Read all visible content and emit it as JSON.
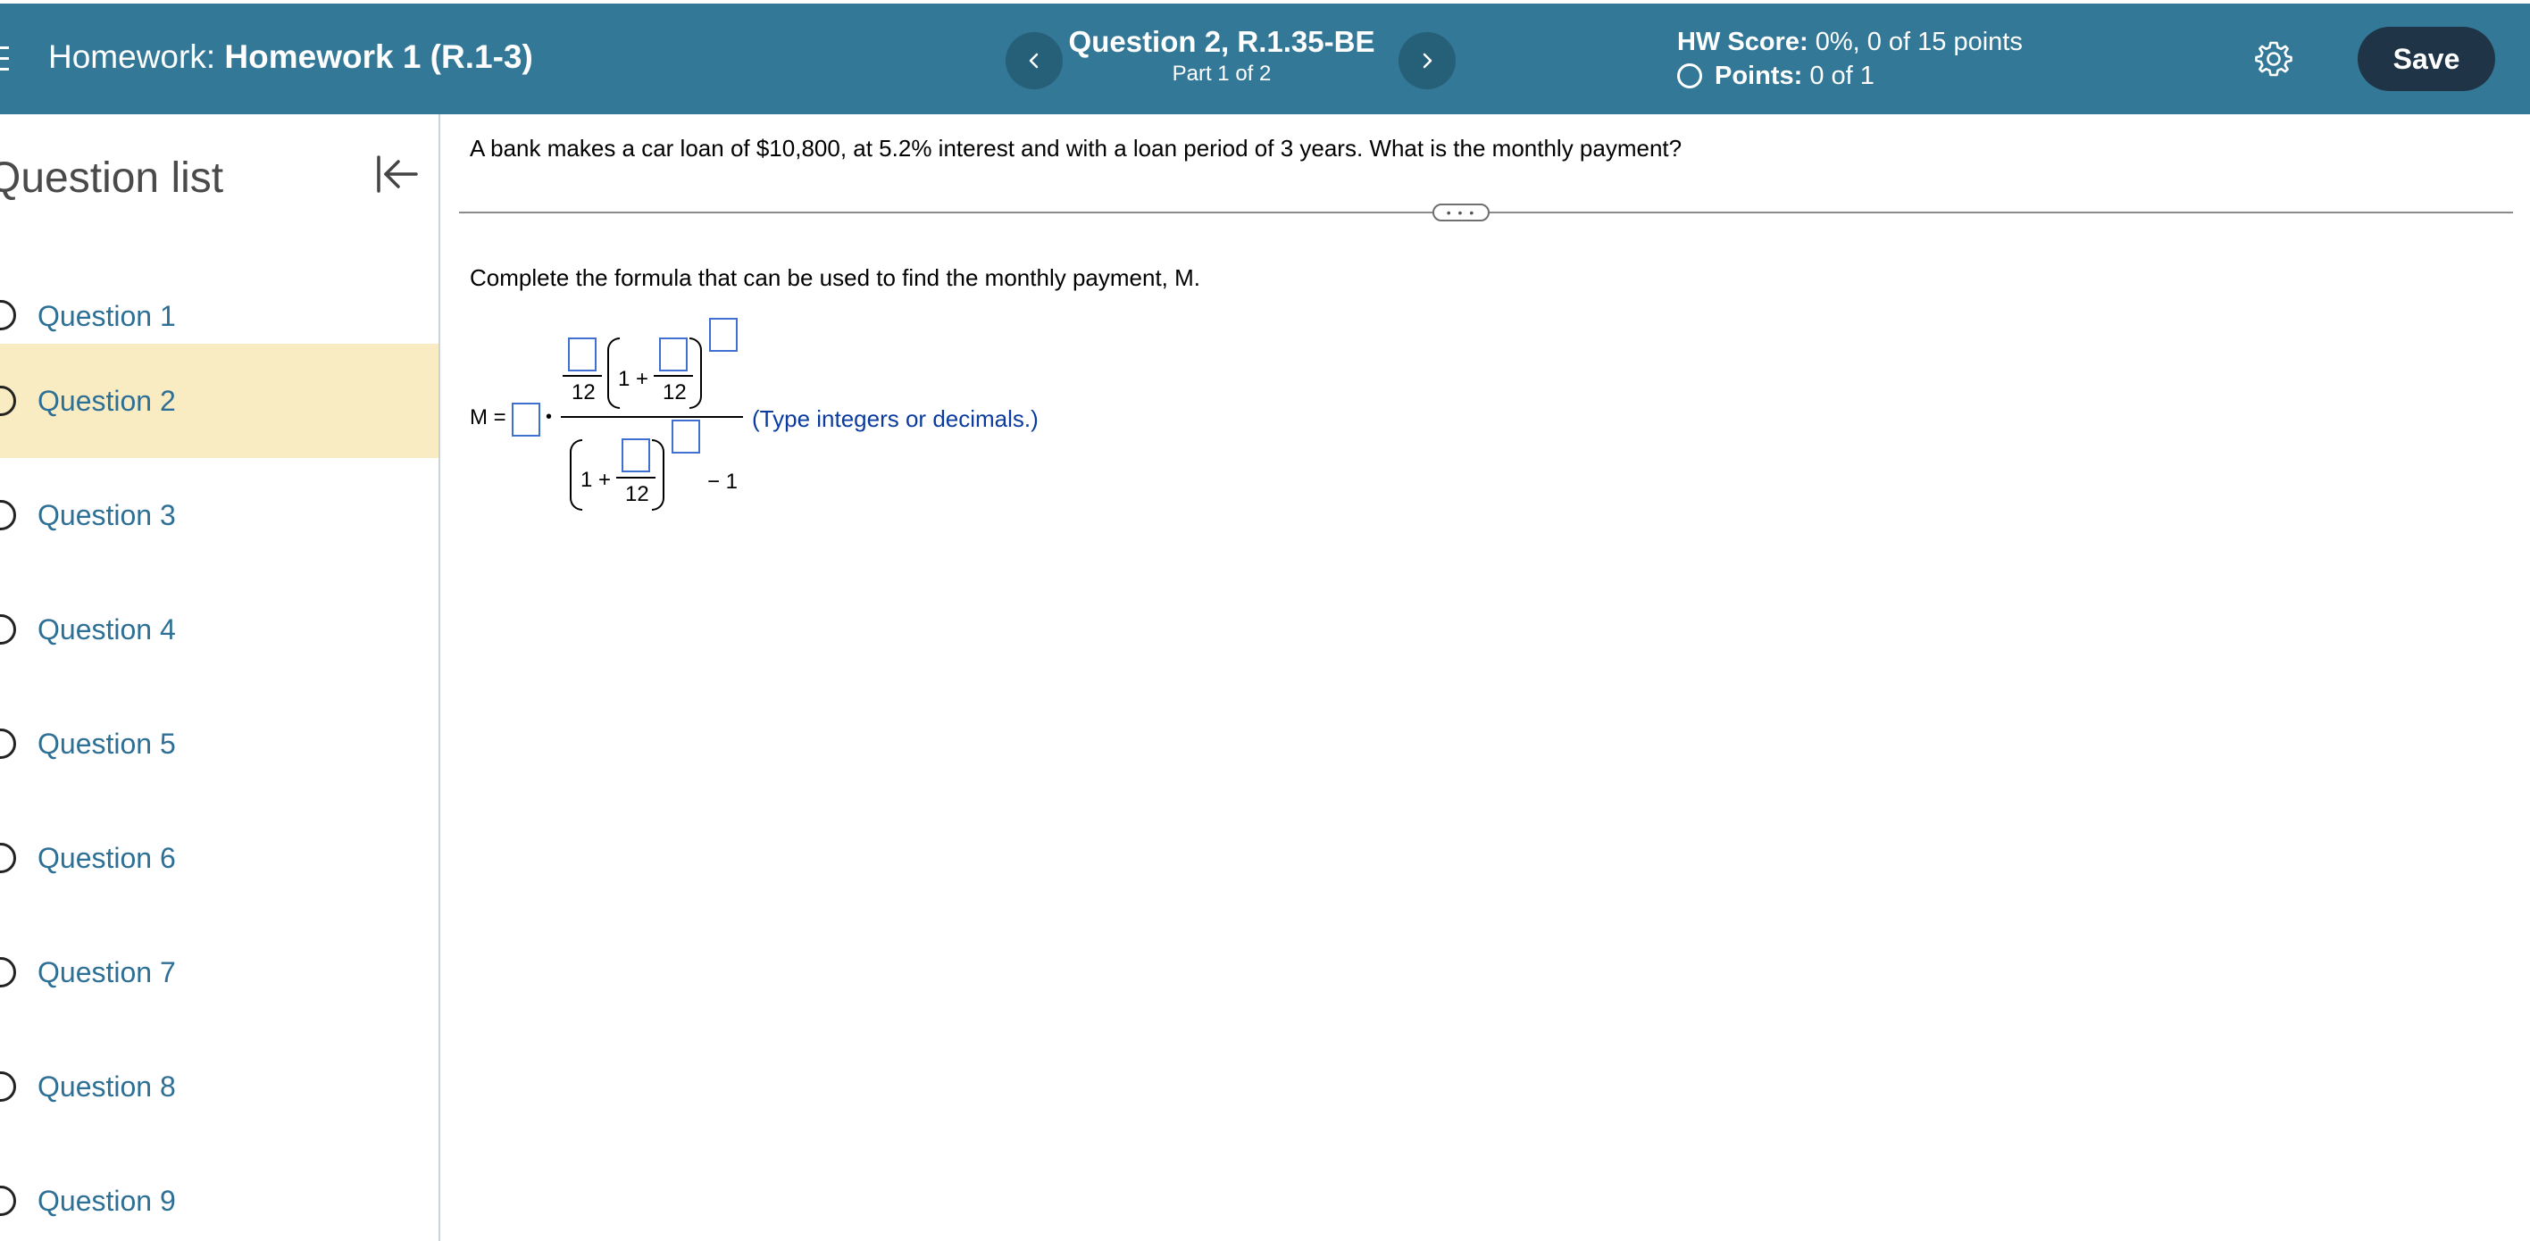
{
  "header": {
    "homework_label": "Homework:",
    "homework_name": "Homework 1 (R.1-3)",
    "question_title": "Question 2, R.1.35-BE",
    "part": "Part 1 of 2",
    "hw_score_label": "HW Score:",
    "hw_score_value": "0%, 0 of 15 points",
    "points_label": "Points:",
    "points_value": "0 of 1",
    "save_label": "Save",
    "color": "#337896",
    "save_color": "#1f3447"
  },
  "sidebar": {
    "title": "Question list",
    "active_color": "#faecc2",
    "items": [
      {
        "label": "Question 1"
      },
      {
        "label": "Question 2"
      },
      {
        "label": "Question 3"
      },
      {
        "label": "Question 4"
      },
      {
        "label": "Question 5"
      },
      {
        "label": "Question 6"
      },
      {
        "label": "Question 7"
      },
      {
        "label": "Question 8"
      },
      {
        "label": "Question 9"
      }
    ]
  },
  "main": {
    "question_text": "A bank makes a car loan of $10,800, at 5.2% interest and with a loan period of 3 years. What is the monthly payment?",
    "instruction": "Complete the formula that can be used to find the monthly payment, M.",
    "formula": {
      "lhs": "M =",
      "dot": "•",
      "one_plus": "1 +",
      "denominator": "12",
      "minus_one": "− 1"
    },
    "hint": "(Type integers or decimals.)"
  }
}
